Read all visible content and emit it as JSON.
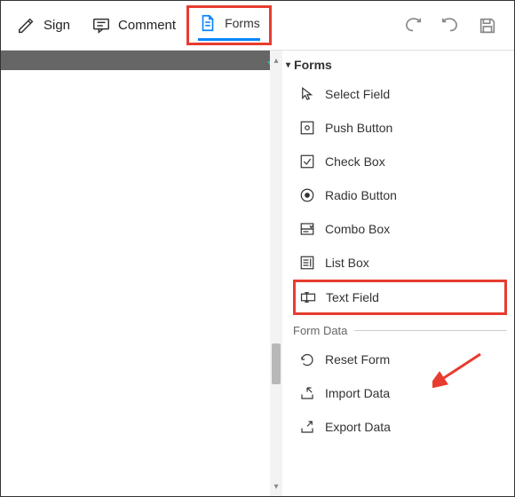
{
  "toolbar": {
    "sign_label": "Sign",
    "comment_label": "Comment",
    "forms_label": "Forms"
  },
  "panel": {
    "header": "Forms",
    "tools": [
      {
        "label": "Select Field"
      },
      {
        "label": "Push Button"
      },
      {
        "label": "Check Box"
      },
      {
        "label": "Radio Button"
      },
      {
        "label": "Combo Box"
      },
      {
        "label": "List Box"
      },
      {
        "label": "Text Field"
      }
    ],
    "form_data_header": "Form Data",
    "form_data_items": [
      {
        "label": "Reset Form"
      },
      {
        "label": "Import Data"
      },
      {
        "label": "Export Data"
      }
    ]
  }
}
